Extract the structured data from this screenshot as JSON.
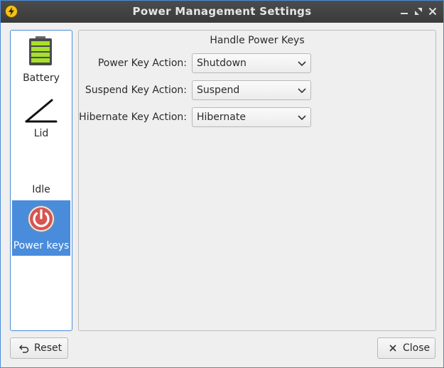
{
  "window": {
    "title": "Power Management Settings"
  },
  "sidebar": {
    "items": [
      {
        "label": "Battery",
        "icon": "battery-icon"
      },
      {
        "label": "Lid",
        "icon": "lid-icon"
      },
      {
        "label": "Idle",
        "icon": "idle-icon"
      },
      {
        "label": "Power keys",
        "icon": "power-icon",
        "selected": true
      }
    ]
  },
  "content": {
    "section_title": "Handle Power Keys",
    "rows": [
      {
        "label": "Power Key Action:",
        "value": "Shutdown"
      },
      {
        "label": "Suspend Key Action:",
        "value": "Suspend"
      },
      {
        "label": "Hibernate Key Action:",
        "value": "Hibernate"
      }
    ]
  },
  "footer": {
    "reset_label": "Reset",
    "close_label": "Close"
  },
  "colors": {
    "accent": "#4a8cdc",
    "titlebar": "#3f3f3f",
    "battery": "#a4e22a",
    "power_icon": "#d9534f",
    "app_icon": "#f3c21a"
  }
}
